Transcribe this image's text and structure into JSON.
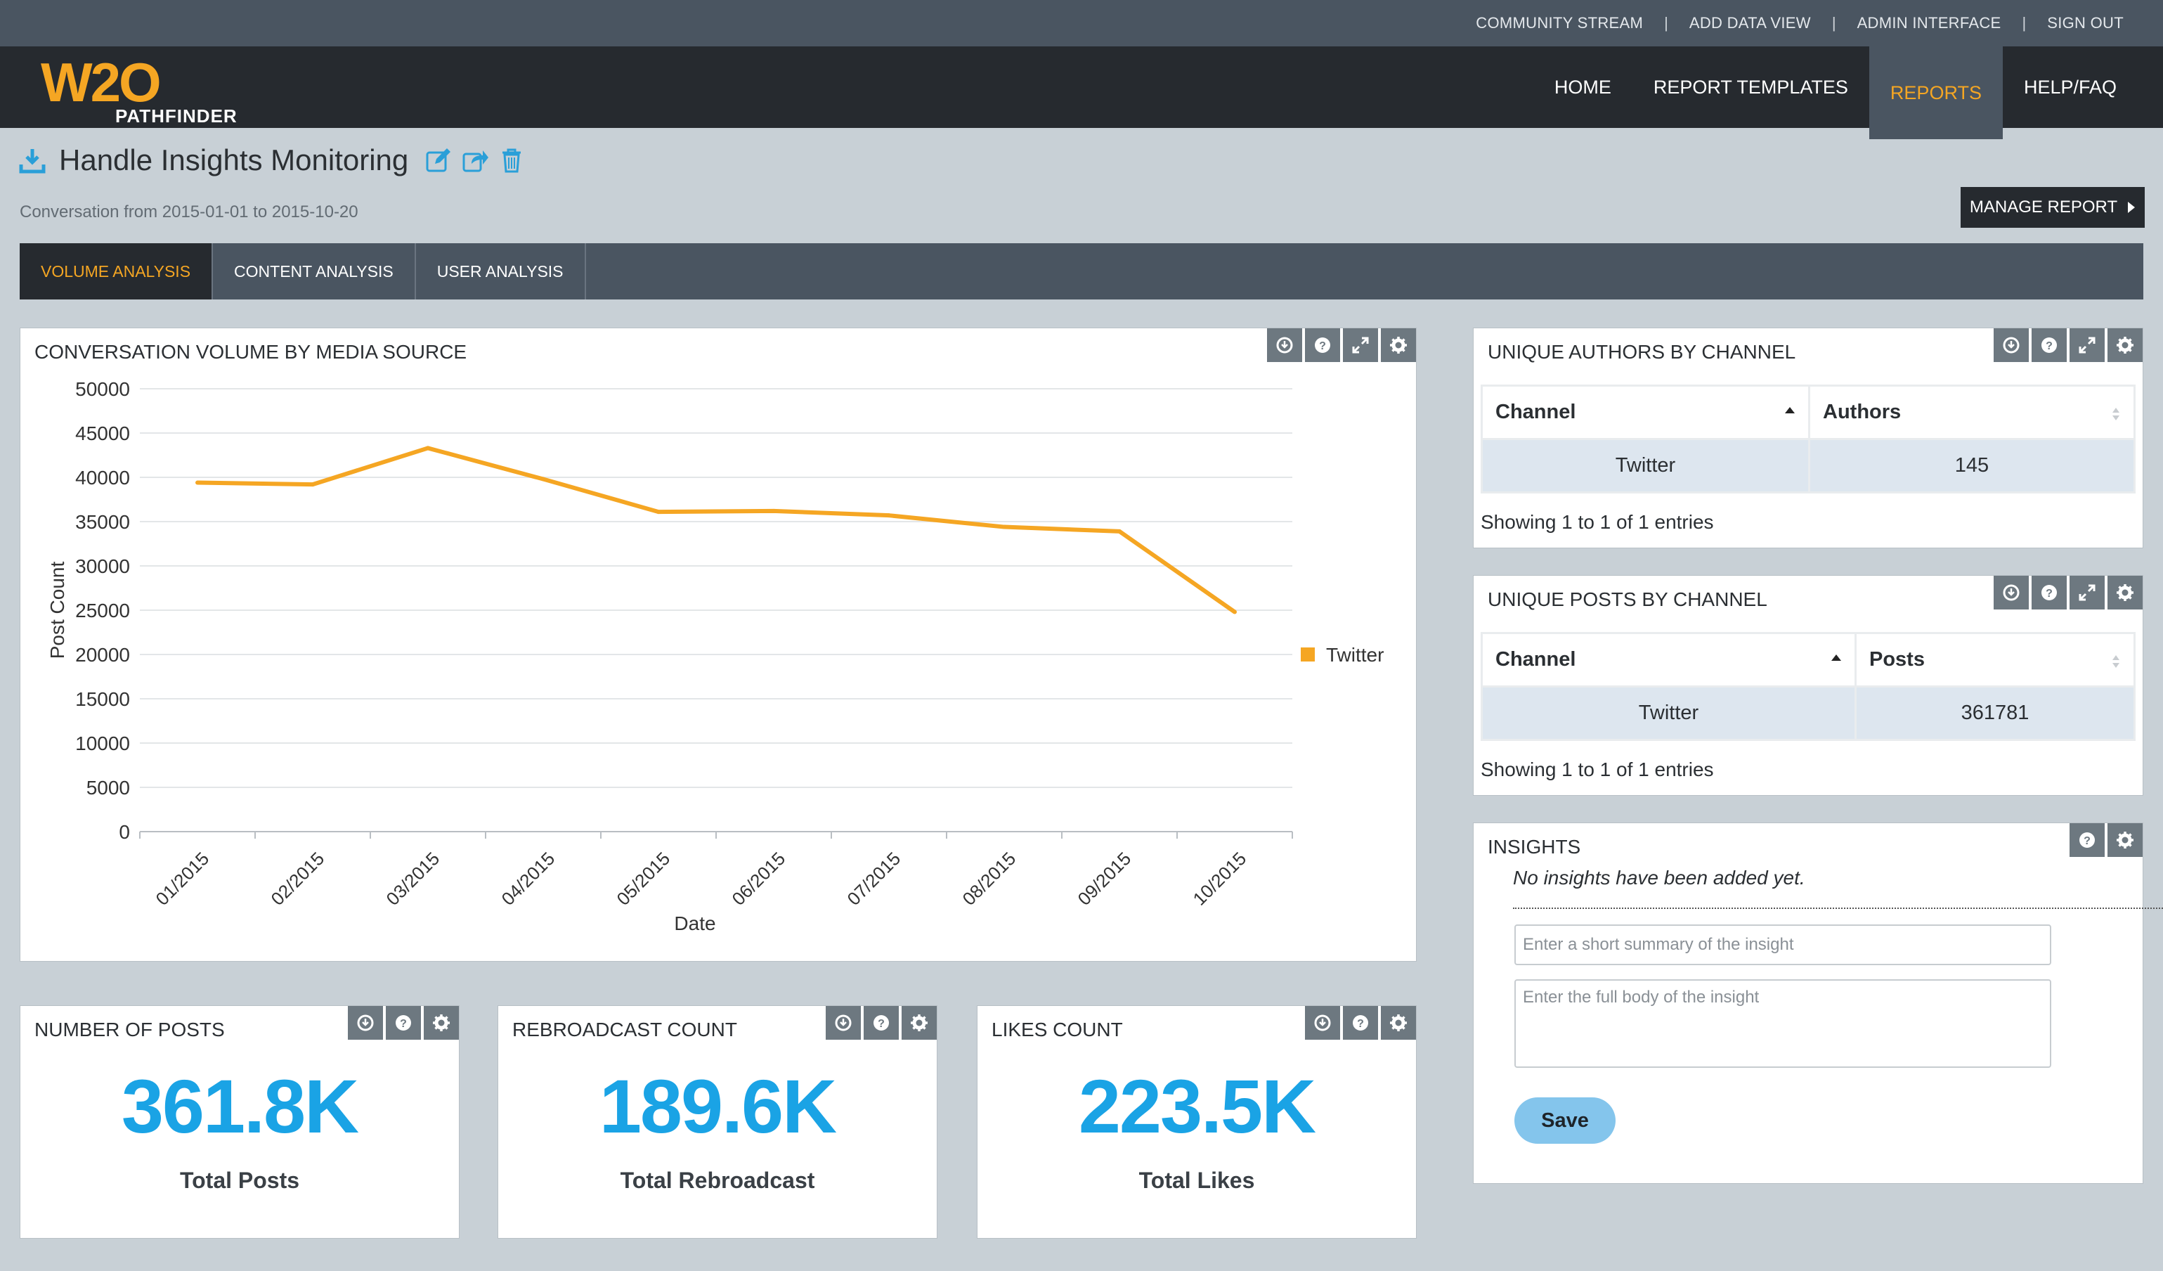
{
  "topbar": {
    "links": [
      "COMMUNITY STREAM",
      "ADD DATA VIEW",
      "ADMIN INTERFACE",
      "SIGN OUT"
    ]
  },
  "logo": {
    "main": "W2O",
    "sub": "PATHFINDER"
  },
  "nav": {
    "items": [
      "HOME",
      "REPORT TEMPLATES",
      "REPORTS",
      "HELP/FAQ"
    ],
    "active": "REPORTS"
  },
  "report": {
    "title": "Handle Insights Monitoring",
    "subtitle": "Conversation from 2015-01-01 to 2015-10-20",
    "manage_label": "MANAGE REPORT"
  },
  "tabs": {
    "items": [
      "VOLUME ANALYSIS",
      "CONTENT ANALYSIS",
      "USER ANALYSIS"
    ],
    "active": "VOLUME ANALYSIS"
  },
  "volume_panel": {
    "title": "CONVERSATION VOLUME BY MEDIA SOURCE"
  },
  "chart_data": {
    "type": "line",
    "title": "CONVERSATION VOLUME BY MEDIA SOURCE",
    "xlabel": "Date",
    "ylabel": "Post Count",
    "categories": [
      "01/2015",
      "02/2015",
      "03/2015",
      "04/2015",
      "05/2015",
      "06/2015",
      "07/2015",
      "08/2015",
      "09/2015",
      "10/2015"
    ],
    "series": [
      {
        "name": "Twitter",
        "color": "#f5a623",
        "values": [
          39400,
          39200,
          43300,
          39800,
          36100,
          36200,
          35700,
          34400,
          33900,
          24800
        ]
      }
    ],
    "ylim": [
      0,
      50000
    ],
    "yticks": [
      0,
      5000,
      10000,
      15000,
      20000,
      25000,
      30000,
      35000,
      40000,
      45000,
      50000
    ],
    "grid": true,
    "legend": "right"
  },
  "authors": {
    "title": "UNIQUE AUTHORS BY CHANNEL",
    "headers": [
      "Channel",
      "Authors"
    ],
    "rows": [
      [
        "Twitter",
        "145"
      ]
    ],
    "showing": "Showing 1 to 1 of 1 entries"
  },
  "posts": {
    "title": "UNIQUE POSTS BY CHANNEL",
    "headers": [
      "Channel",
      "Posts"
    ],
    "rows": [
      [
        "Twitter",
        "361781"
      ]
    ],
    "showing": "Showing 1 to 1 of 1 entries"
  },
  "insights": {
    "title": "INSIGHTS",
    "empty": "No insights have been added yet.",
    "summary_placeholder": "Enter a short summary of the insight",
    "body_placeholder": "Enter the full body of the insight",
    "save_label": "Save"
  },
  "stats": [
    {
      "title": "NUMBER OF POSTS",
      "value": "361.8K",
      "label": "Total Posts"
    },
    {
      "title": "REBROADCAST COUNT",
      "value": "189.6K",
      "label": "Total Rebroadcast"
    },
    {
      "title": "LIKES COUNT",
      "value": "223.5K",
      "label": "Total Likes"
    }
  ],
  "colors": {
    "accent": "#f5a623",
    "stat_blue": "#1aa3e5",
    "nav_dark": "#262a2f",
    "nav_mid": "#4a5561"
  }
}
